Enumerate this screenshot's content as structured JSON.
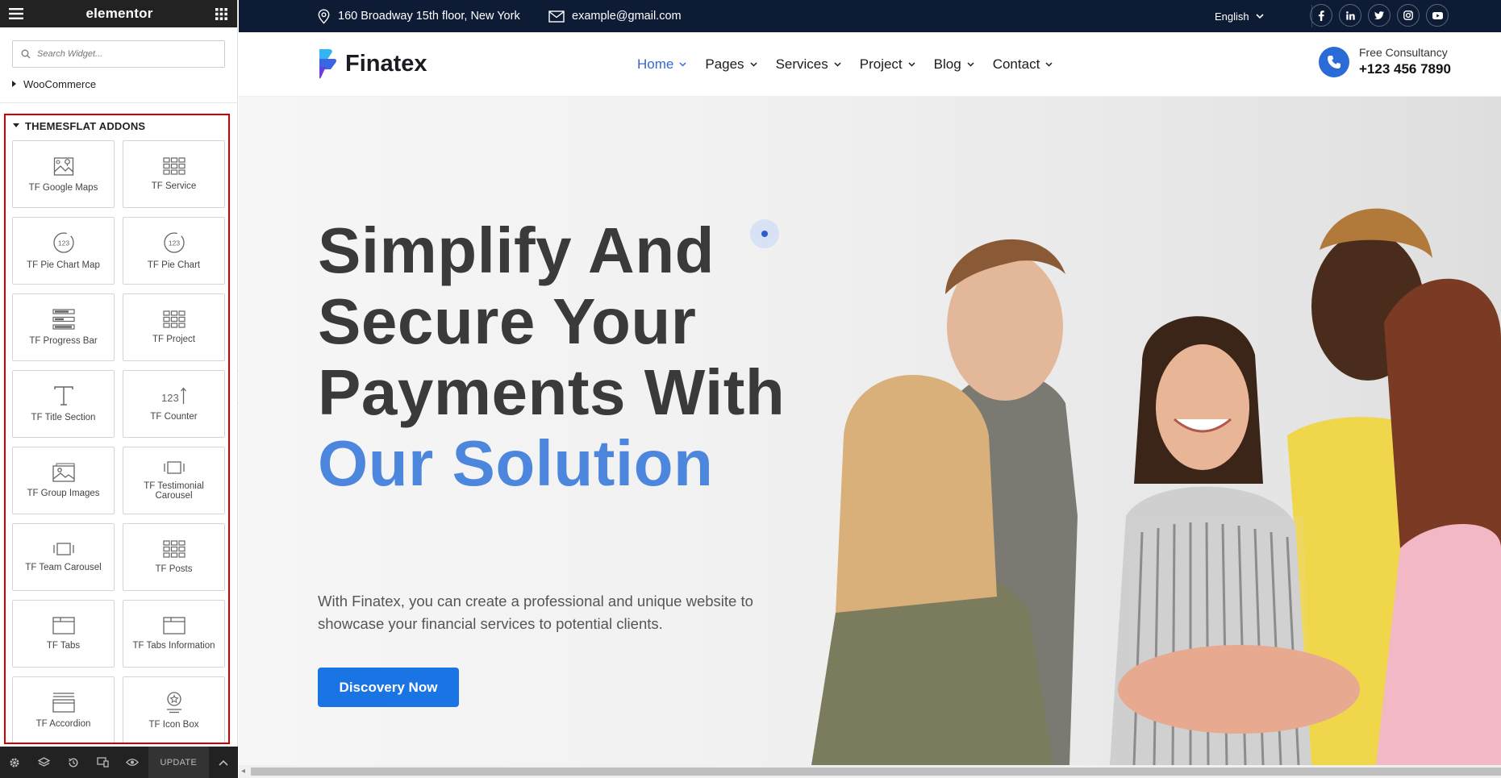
{
  "panel": {
    "logo": "elementor",
    "search_placeholder": "Search Widget...",
    "woocommerce_label": "WooCommerce",
    "category_title": "THEMESFLAT ADDONS",
    "widgets": [
      {
        "label": "TF Google Maps",
        "icon": "map-icon"
      },
      {
        "label": "TF Service",
        "icon": "grid-icon"
      },
      {
        "label": "TF Pie Chart Map",
        "icon": "counter-circle-icon"
      },
      {
        "label": "TF Pie Chart",
        "icon": "counter-circle-icon"
      },
      {
        "label": "TF Progress Bar",
        "icon": "progress-bar-icon"
      },
      {
        "label": "TF Project",
        "icon": "grid-icon"
      },
      {
        "label": "TF Title Section",
        "icon": "title-icon"
      },
      {
        "label": "TF Counter",
        "icon": "counter-icon"
      },
      {
        "label": "TF Group Images",
        "icon": "image-icon"
      },
      {
        "label": "TF Testimonial Carousel",
        "icon": "carousel-icon"
      },
      {
        "label": "TF Team Carousel",
        "icon": "carousel-icon"
      },
      {
        "label": "TF Posts",
        "icon": "grid-icon"
      },
      {
        "label": "TF Tabs",
        "icon": "tabs-icon"
      },
      {
        "label": "TF Tabs Information",
        "icon": "tabs-icon"
      },
      {
        "label": "TF Accordion",
        "icon": "accordion-icon"
      },
      {
        "label": "TF Icon Box",
        "icon": "icon-box-icon"
      }
    ],
    "footer": {
      "update_label": "UPDATE"
    }
  },
  "site": {
    "topbar": {
      "address": "160 Broadway 15th floor, New York",
      "email": "example@gmail.com",
      "language": "English",
      "social": [
        "facebook-icon",
        "linkedin-icon",
        "twitter-icon",
        "instagram-icon",
        "youtube-icon"
      ]
    },
    "brand": "Finatex",
    "menu": [
      {
        "label": "Home",
        "active": true
      },
      {
        "label": "Pages"
      },
      {
        "label": "Services"
      },
      {
        "label": "Project"
      },
      {
        "label": "Blog"
      },
      {
        "label": "Contact"
      }
    ],
    "consult": {
      "label": "Free Consultancy",
      "phone": "+123 456 7890"
    },
    "hero": {
      "line1": "Simplify And",
      "line2": "Secure Your",
      "line3": "Payments With",
      "line4": "Our Solution",
      "description": "With Finatex, you can create a professional and unique website to showcase your financial services to potential clients.",
      "cta": "Discovery Now"
    }
  },
  "colors": {
    "accent": "#1b74e4",
    "heading_blue": "#4c86dd",
    "topbar_bg": "#0d1b35",
    "highlight_border": "#d40000"
  }
}
